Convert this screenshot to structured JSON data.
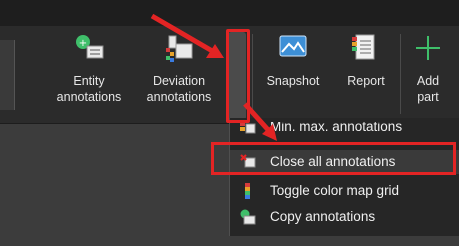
{
  "ribbon": {
    "buttons": [
      {
        "label1": "Entity",
        "label2": "annotations"
      },
      {
        "label1": "Deviation",
        "label2": "annotations"
      },
      {
        "label1": "Snapshot",
        "label2": ""
      },
      {
        "label1": "Report",
        "label2": ""
      },
      {
        "label1": "Add",
        "label2": "part"
      }
    ]
  },
  "menu": {
    "items": [
      {
        "label": "Min. max. annotations",
        "icon": "min-max-annotations-icon"
      },
      {
        "label": "Close all annotations",
        "icon": "close-annotations-icon"
      },
      {
        "label": "Toggle color map grid",
        "icon": "color-map-grid-icon"
      },
      {
        "label": "Copy annotations",
        "icon": "copy-annotations-icon"
      }
    ]
  },
  "colors": {
    "highlight": "#e32424",
    "ribbon_bg": "#2b2b2b",
    "menu_bg": "#262626"
  }
}
